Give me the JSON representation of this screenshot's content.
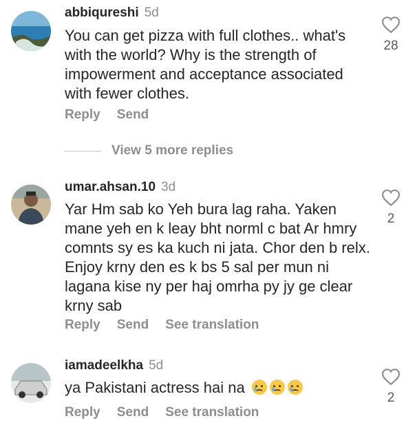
{
  "comments": [
    {
      "username": "abbiqureshi",
      "time": "5d",
      "text": "You can get pizza with full clothes.. what's with the world? Why is the strength of impowerment  and acceptance associated with fewer clothes.",
      "likes": "28",
      "actions": [
        "Reply",
        "Send"
      ],
      "avatar_icon": "ocean-rocks-avatar"
    },
    {
      "username": "umar.ahsan.10",
      "time": "3d",
      "text": "Yar Hm sab ko Yeh bura lag raha.  Yaken mane yeh en k leay bht norml c bat Ar hmry comnts sy es ka kuch ni jata.  Chor den b relx.  Enjoy krny den es k bs 5 sal per mun ni lagana kise ny per haj omrha py jy ge clear krny sab",
      "likes": "2",
      "actions": [
        "Reply",
        "Send",
        "See translation"
      ],
      "avatar_icon": "person-avatar"
    },
    {
      "username": "iamadeelkha",
      "time": "5d",
      "text": "ya Pakistani actress hai na",
      "likes": "2",
      "actions": [
        "Reply",
        "Send",
        "See translation"
      ],
      "avatar_icon": "car-avatar",
      "emoji": [
        "crying-face-icon",
        "crying-face-icon",
        "crying-face-icon"
      ]
    }
  ],
  "more_replies_label": "View 5 more replies",
  "colors": {
    "text": "#262626",
    "muted": "#8e8e8e"
  }
}
